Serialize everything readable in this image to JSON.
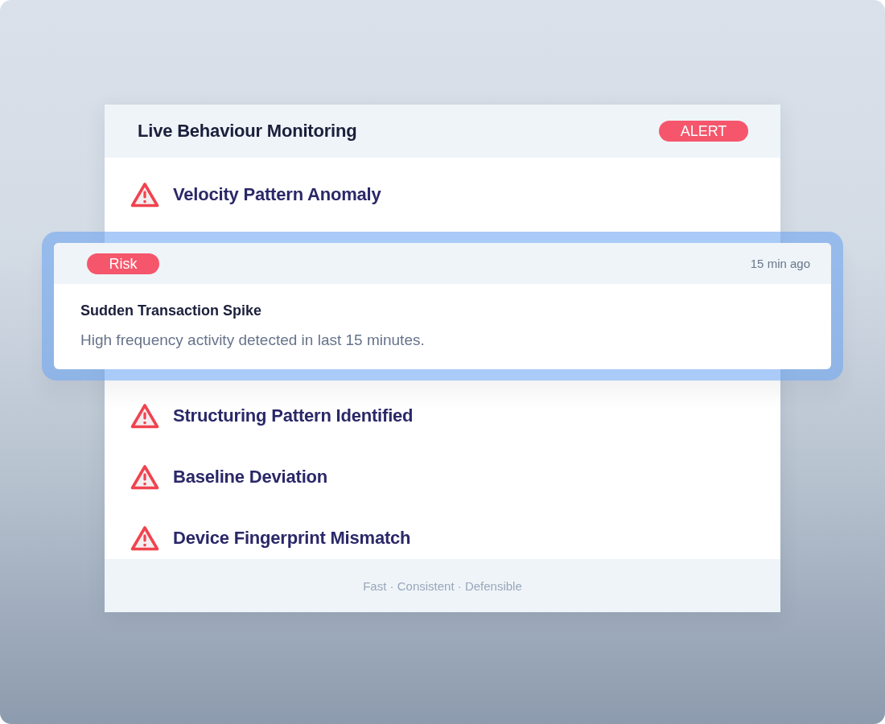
{
  "panel": {
    "title": "Live Behaviour Monitoring",
    "badge": "ALERT"
  },
  "alerts": [
    {
      "kind": "row",
      "title": "Velocity Pattern Anomaly"
    },
    {
      "kind": "detail",
      "tag": "Risk",
      "time": "15 min ago",
      "title": "Sudden Transaction Spike",
      "description": "High frequency activity detected in last 15 minutes."
    },
    {
      "kind": "row",
      "title": "Structuring Pattern Identified"
    },
    {
      "kind": "row",
      "title": "Baseline Deviation"
    },
    {
      "kind": "row",
      "title": "Device Fingerprint Mismatch"
    }
  ],
  "footer": "Fast · Consistent · Defensible"
}
